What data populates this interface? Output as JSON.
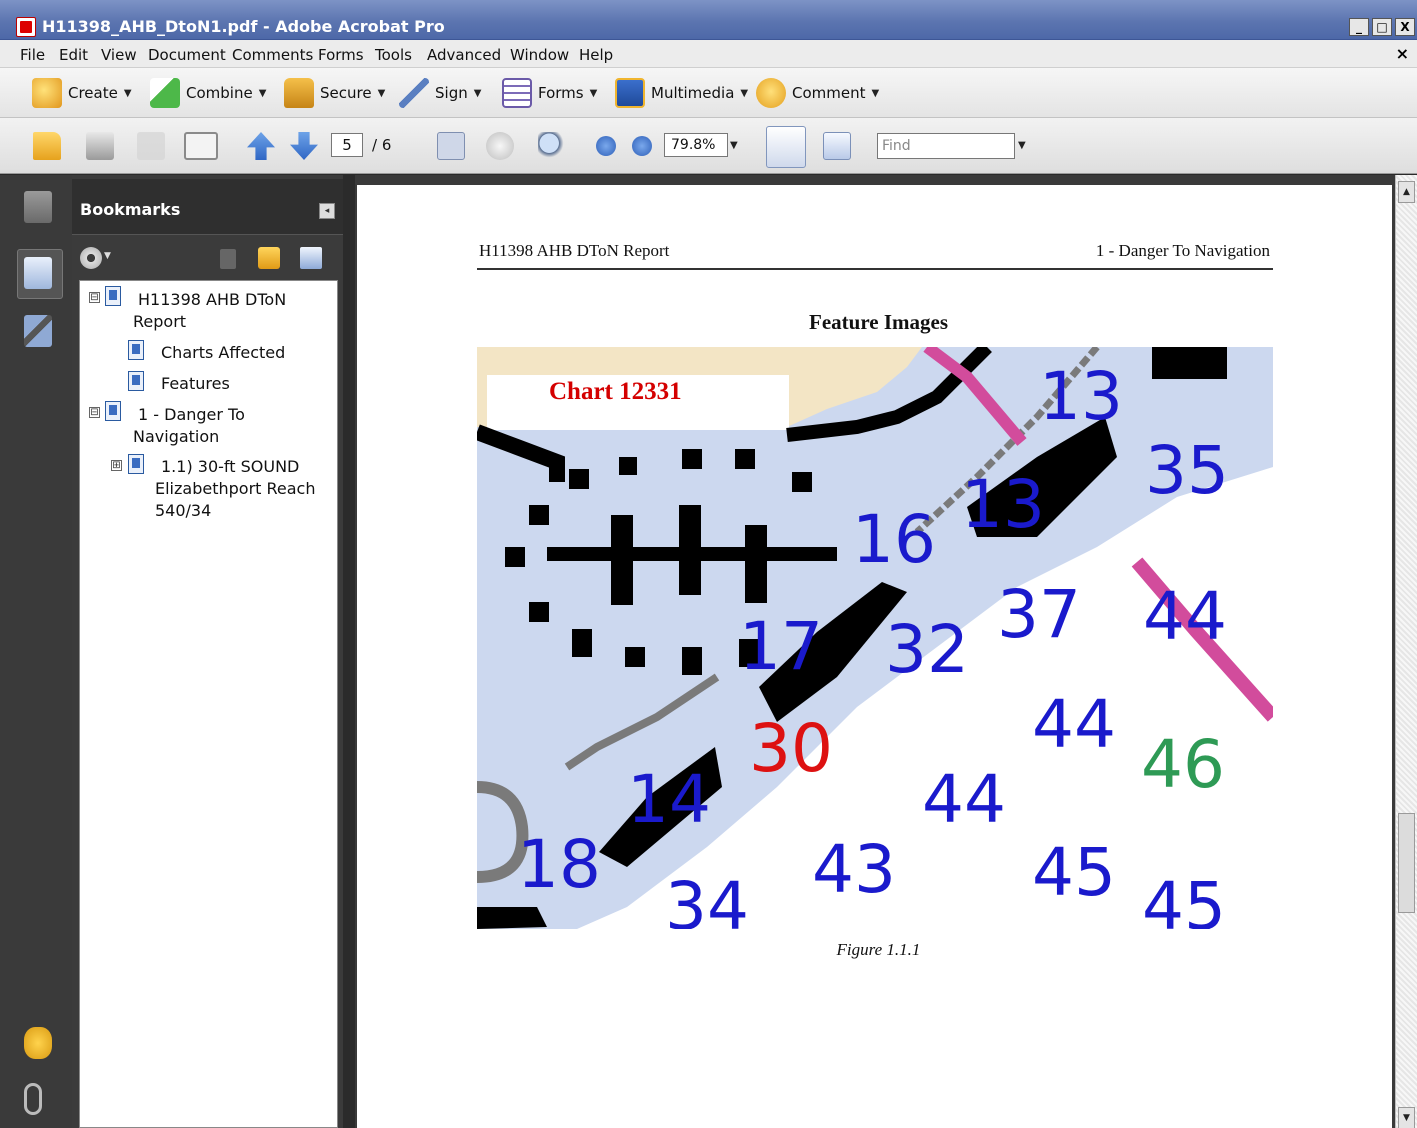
{
  "window": {
    "title": "H11398_AHB_DtoN1.pdf - Adobe Acrobat Pro",
    "minimize": "_",
    "maximize": "□",
    "close": "X",
    "doc_close": "×"
  },
  "menu": [
    "File",
    "Edit",
    "View",
    "Document",
    "Comments",
    "Forms",
    "Tools",
    "Advanced",
    "Window",
    "Help"
  ],
  "tasks": [
    {
      "label": "Create",
      "icon": "create-icon"
    },
    {
      "label": "Combine",
      "icon": "combine-icon"
    },
    {
      "label": "Secure",
      "icon": "lock-icon"
    },
    {
      "label": "Sign",
      "icon": "pen-icon"
    },
    {
      "label": "Forms",
      "icon": "forms-icon"
    },
    {
      "label": "Multimedia",
      "icon": "film-icon"
    },
    {
      "label": "Comment",
      "icon": "comment-icon"
    }
  ],
  "nav": {
    "page_current": "5",
    "page_total": "/ 6",
    "zoom": "79.8%",
    "find_placeholder": "Find"
  },
  "bookmarks": {
    "title": "Bookmarks",
    "collapse": "◂",
    "items": [
      {
        "label_line1": "H11398 AHB DToN",
        "label_line2": "Report",
        "toggle": "⊟"
      },
      {
        "label_line1": "Charts Affected"
      },
      {
        "label_line1": "Features"
      },
      {
        "label_line1": "1 - Danger To",
        "label_line2": "Navigation",
        "toggle": "⊟"
      },
      {
        "label_line1": "1.1)  30-ft SOUND",
        "label_line2": "Elizabethport Reach",
        "label_line3": "540/34",
        "toggle": "⊞"
      }
    ]
  },
  "document": {
    "header_left": "H11398 AHB DToN Report",
    "header_right": "1 - Danger To Navigation",
    "section_title": "Feature Images",
    "chart_label": "Chart 12331",
    "caption": "Figure 1.1.1",
    "soundings": [
      {
        "text": "13",
        "color": "#1a1acc"
      },
      {
        "text": "35",
        "color": "#1a1acc"
      },
      {
        "text": "13",
        "color": "#1a1acc"
      },
      {
        "text": "16",
        "color": "#1a1acc"
      },
      {
        "text": "37",
        "color": "#1a1acc"
      },
      {
        "text": "44",
        "color": "#1a1acc"
      },
      {
        "text": "17",
        "color": "#1a1acc"
      },
      {
        "text": "32",
        "color": "#1a1acc"
      },
      {
        "text": "44",
        "color": "#1a1acc"
      },
      {
        "text": "30",
        "color": "#dd1111"
      },
      {
        "text": "46",
        "color": "#2e9a55"
      },
      {
        "text": "14",
        "color": "#1a1acc"
      },
      {
        "text": "44",
        "color": "#1a1acc"
      },
      {
        "text": "18",
        "color": "#1a1acc"
      },
      {
        "text": "43",
        "color": "#1a1acc"
      },
      {
        "text": "45",
        "color": "#1a1acc"
      },
      {
        "text": "34",
        "color": "#1a1acc"
      },
      {
        "text": "45",
        "color": "#1a1acc"
      }
    ]
  },
  "colors": {
    "land": "#f3e5c5",
    "water": "#ccd8ef",
    "deep_water": "#ffffff",
    "restricted_line": "#d24c9c",
    "channel_line": "#7a7a7a"
  }
}
